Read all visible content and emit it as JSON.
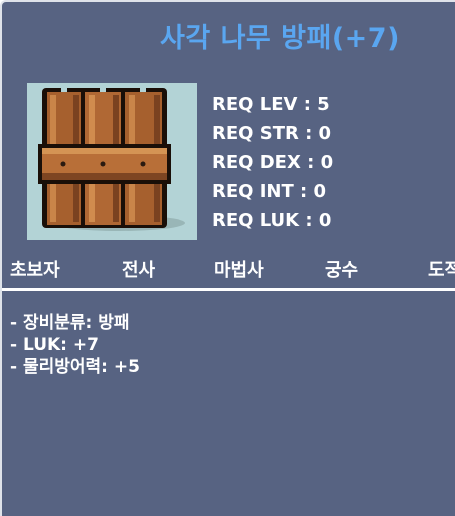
{
  "item": {
    "name": "사각 나무 방패(+7)",
    "name_color": "#5aa6f0",
    "icon": "wooden-shield-icon"
  },
  "requirements": [
    {
      "label": "REQ LEV : 5"
    },
    {
      "label": "REQ STR : 0"
    },
    {
      "label": "REQ DEX : 0"
    },
    {
      "label": "REQ INT : 0"
    },
    {
      "label": "REQ LUK : 0"
    }
  ],
  "jobs": [
    "초보자",
    "전사",
    "마법사",
    "궁수",
    "도적"
  ],
  "description": [
    "- 장비분류: 방패",
    "- LUK: +7",
    "- 물리방어력: +5"
  ],
  "colors": {
    "background": "#576382",
    "text": "#ffffff",
    "title": "#5aa6f0"
  }
}
